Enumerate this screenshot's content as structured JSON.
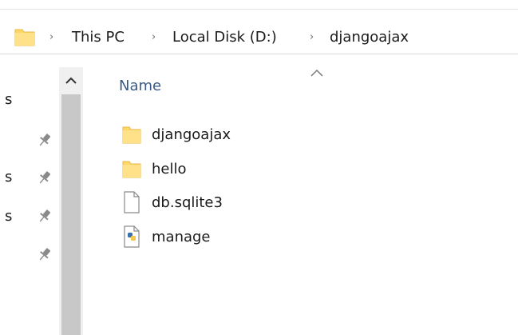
{
  "address_bar": {
    "breadcrumbs": [
      "This PC",
      "Local Disk (D:)",
      "djangoajax"
    ],
    "folder_icon": "folder-icon",
    "separator_icon": "chevron-right-icon"
  },
  "nav_pane": {
    "truncated_labels": [
      "s",
      "s",
      "s"
    ],
    "pin_icon": "pin-icon"
  },
  "content": {
    "column_header": "Name",
    "sort_indicator": "sort-ascending-icon",
    "items": [
      {
        "name": "djangoajax",
        "type": "folder"
      },
      {
        "name": "hello",
        "type": "folder"
      },
      {
        "name": "db.sqlite3",
        "type": "file"
      },
      {
        "name": "manage",
        "type": "python-file"
      }
    ]
  },
  "colors": {
    "folder": "#ffd766",
    "folder_dark": "#e8b84a",
    "header_text": "#3a5a84",
    "scroll_thumb": "#c8c8c8",
    "scroll_track": "#f0f0f0"
  }
}
